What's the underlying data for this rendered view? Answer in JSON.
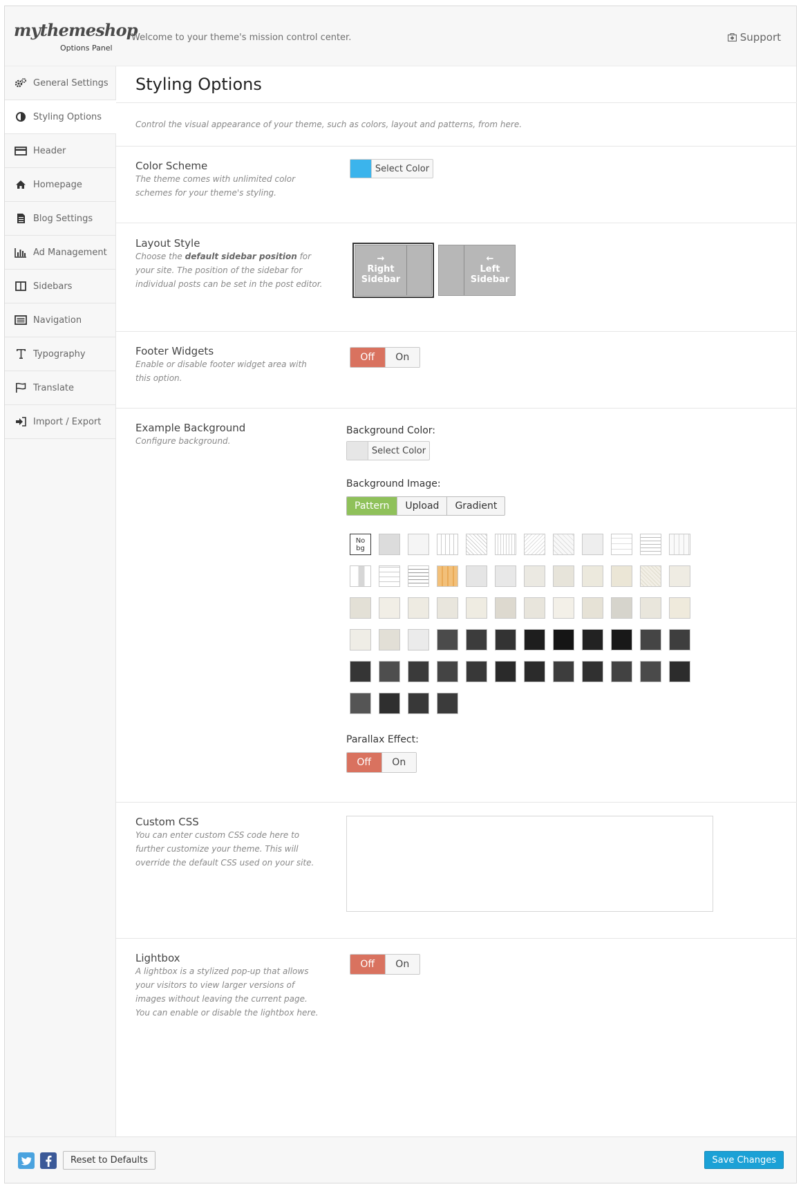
{
  "brand": {
    "logo": "mythemeshop",
    "subtitle": "Options Panel",
    "welcome": "Welcome to your theme's mission control center.",
    "support": "Support"
  },
  "sidebar": {
    "items": [
      {
        "label": "General Settings",
        "icon": "gears-icon"
      },
      {
        "label": "Styling Options",
        "icon": "contrast-icon"
      },
      {
        "label": "Header",
        "icon": "card-icon"
      },
      {
        "label": "Homepage",
        "icon": "home-icon"
      },
      {
        "label": "Blog Settings",
        "icon": "document-icon"
      },
      {
        "label": "Ad Management",
        "icon": "bar-chart-icon"
      },
      {
        "label": "Sidebars",
        "icon": "columns-icon"
      },
      {
        "label": "Navigation",
        "icon": "list-icon"
      },
      {
        "label": "Typography",
        "icon": "text-icon"
      },
      {
        "label": "Translate",
        "icon": "flag-icon"
      },
      {
        "label": "Import / Export",
        "icon": "sign-in-icon"
      }
    ],
    "active": "Styling Options"
  },
  "main": {
    "title": "Styling Options",
    "intro": "Control the visual appearance of your theme, such as colors, layout and patterns, from here.",
    "color_scheme": {
      "label": "Color Scheme",
      "desc": "The theme comes with unlimited color schemes for your theme's styling.",
      "button": "Select Color",
      "color": "#3bb4ec"
    },
    "layout_style": {
      "label": "Layout Style",
      "desc_pre": "Choose the ",
      "desc_bold": "default sidebar position",
      "desc_post": " for your site. The position of the sidebar for individual posts can be set in the post editor.",
      "right": {
        "arrow": "→",
        "line1": "Right",
        "line2": "Sidebar"
      },
      "left": {
        "arrow": "←",
        "line1": "Left",
        "line2": "Sidebar"
      }
    },
    "footer_widgets": {
      "label": "Footer Widgets",
      "desc": "Enable or disable footer widget area with this option.",
      "off": "Off",
      "on": "On"
    },
    "background": {
      "label": "Example Background",
      "desc": "Configure background.",
      "color_label": "Background Color:",
      "color_button": "Select Color",
      "color": "#e6e6e6",
      "image_label": "Background Image:",
      "tabs": [
        "Pattern",
        "Upload",
        "Gradient"
      ],
      "active_tab": "Pattern",
      "no_bg_line1": "No",
      "no_bg_line2": "bg",
      "parallax_label": "Parallax Effect:",
      "off": "Off",
      "on": "On"
    },
    "custom_css": {
      "label": "Custom CSS",
      "desc": "You can enter custom CSS code here to further customize your theme. This will override the default CSS used on your site.",
      "value": ""
    },
    "lightbox": {
      "label": "Lightbox",
      "desc": "A lightbox is a stylized pop-up that allows your visitors to view larger versions of images without leaving the current page. You can enable or disable the lightbox here.",
      "off": "Off",
      "on": "On"
    }
  },
  "footer": {
    "reset": "Reset to Defaults",
    "save": "Save Changes"
  },
  "colors": {
    "accent": "#1ba1d6",
    "off": "#d9725f",
    "pattern_active": "#8fc15a"
  }
}
